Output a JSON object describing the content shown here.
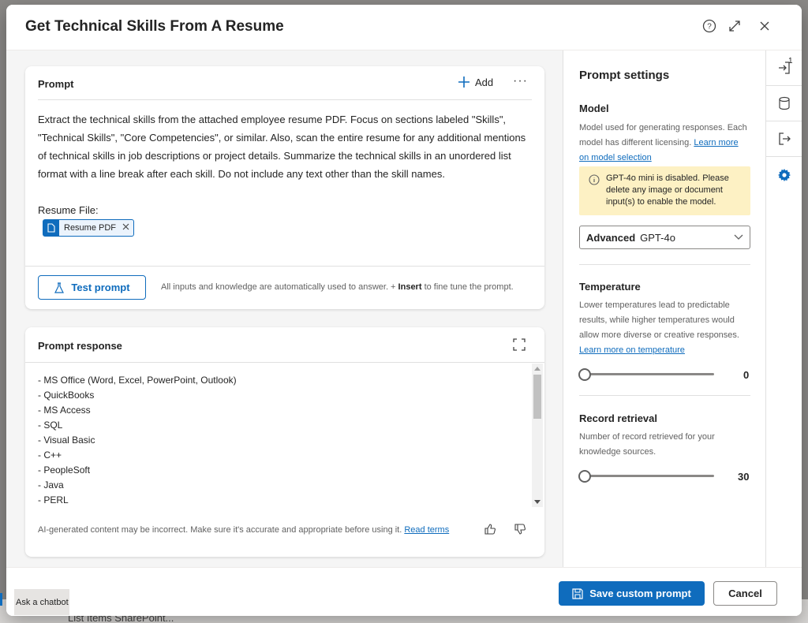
{
  "dialog": {
    "title": "Get Technical Skills From A Resume",
    "header_icons": [
      "help-icon",
      "expand-icon",
      "close-icon"
    ]
  },
  "prompt": {
    "title": "Prompt",
    "add_label": "Add",
    "text": "Extract the technical skills from the attached employee resume PDF. Focus on sections labeled \"Skills\", \"Technical Skills\", \"Core Competencies\", or similar. Also, scan the entire resume for any additional mentions of technical skills in job descriptions or project details. Summarize the technical skills in an unordered list format with a line break after each skill. Do not include any text other than the skill names.",
    "file_label": "Resume File:",
    "chip_label": "Resume PDF",
    "test_button": "Test prompt",
    "hint_prefix": "All inputs and knowledge are automatically used to answer. + ",
    "hint_bold": "Insert",
    "hint_suffix": " to fine tune the prompt."
  },
  "response": {
    "title": "Prompt response",
    "items": [
      "- MS Office (Word, Excel, PowerPoint, Outlook)",
      "- QuickBooks",
      "- MS Access",
      "- SQL",
      "- Visual Basic",
      "- C++",
      "- PeopleSoft",
      "- Java",
      "- PERL"
    ],
    "disclaimer": "AI-generated content may be incorrect. Make sure it's accurate and appropriate before using it.",
    "read_terms": "Read terms"
  },
  "settings": {
    "title": "Prompt settings",
    "model": {
      "title": "Model",
      "desc": "Model used for generating responses. Each model has different licensing.",
      "link": "Learn more on model selection",
      "warning": "GPT-4o mini is disabled. Please delete any image or document input(s) to enable the model.",
      "select_bold": "Advanced",
      "select_value": "GPT-4o"
    },
    "temperature": {
      "title": "Temperature",
      "desc": "Lower temperatures lead to predictable results, while higher temperatures would allow more diverse or creative responses.",
      "link": "Learn more on temperature",
      "value": "0",
      "fraction": 0
    },
    "record": {
      "title": "Record retrieval",
      "desc": "Number of record retrieved for your knowledge sources.",
      "value": "30",
      "fraction": 0
    }
  },
  "rail": {
    "badge": "1",
    "icons": [
      "sign-in-icon",
      "database-icon",
      "sign-out-icon",
      "gear-icon"
    ]
  },
  "footer": {
    "save_label": "Save custom prompt",
    "cancel_label": "Cancel"
  },
  "background": {
    "chatbot_label": "Ask a chatbot",
    "list_text": "List Items SharePoint..."
  },
  "colors": {
    "accent": "#0f6cbd",
    "warning_bg": "#fdf1c4"
  }
}
